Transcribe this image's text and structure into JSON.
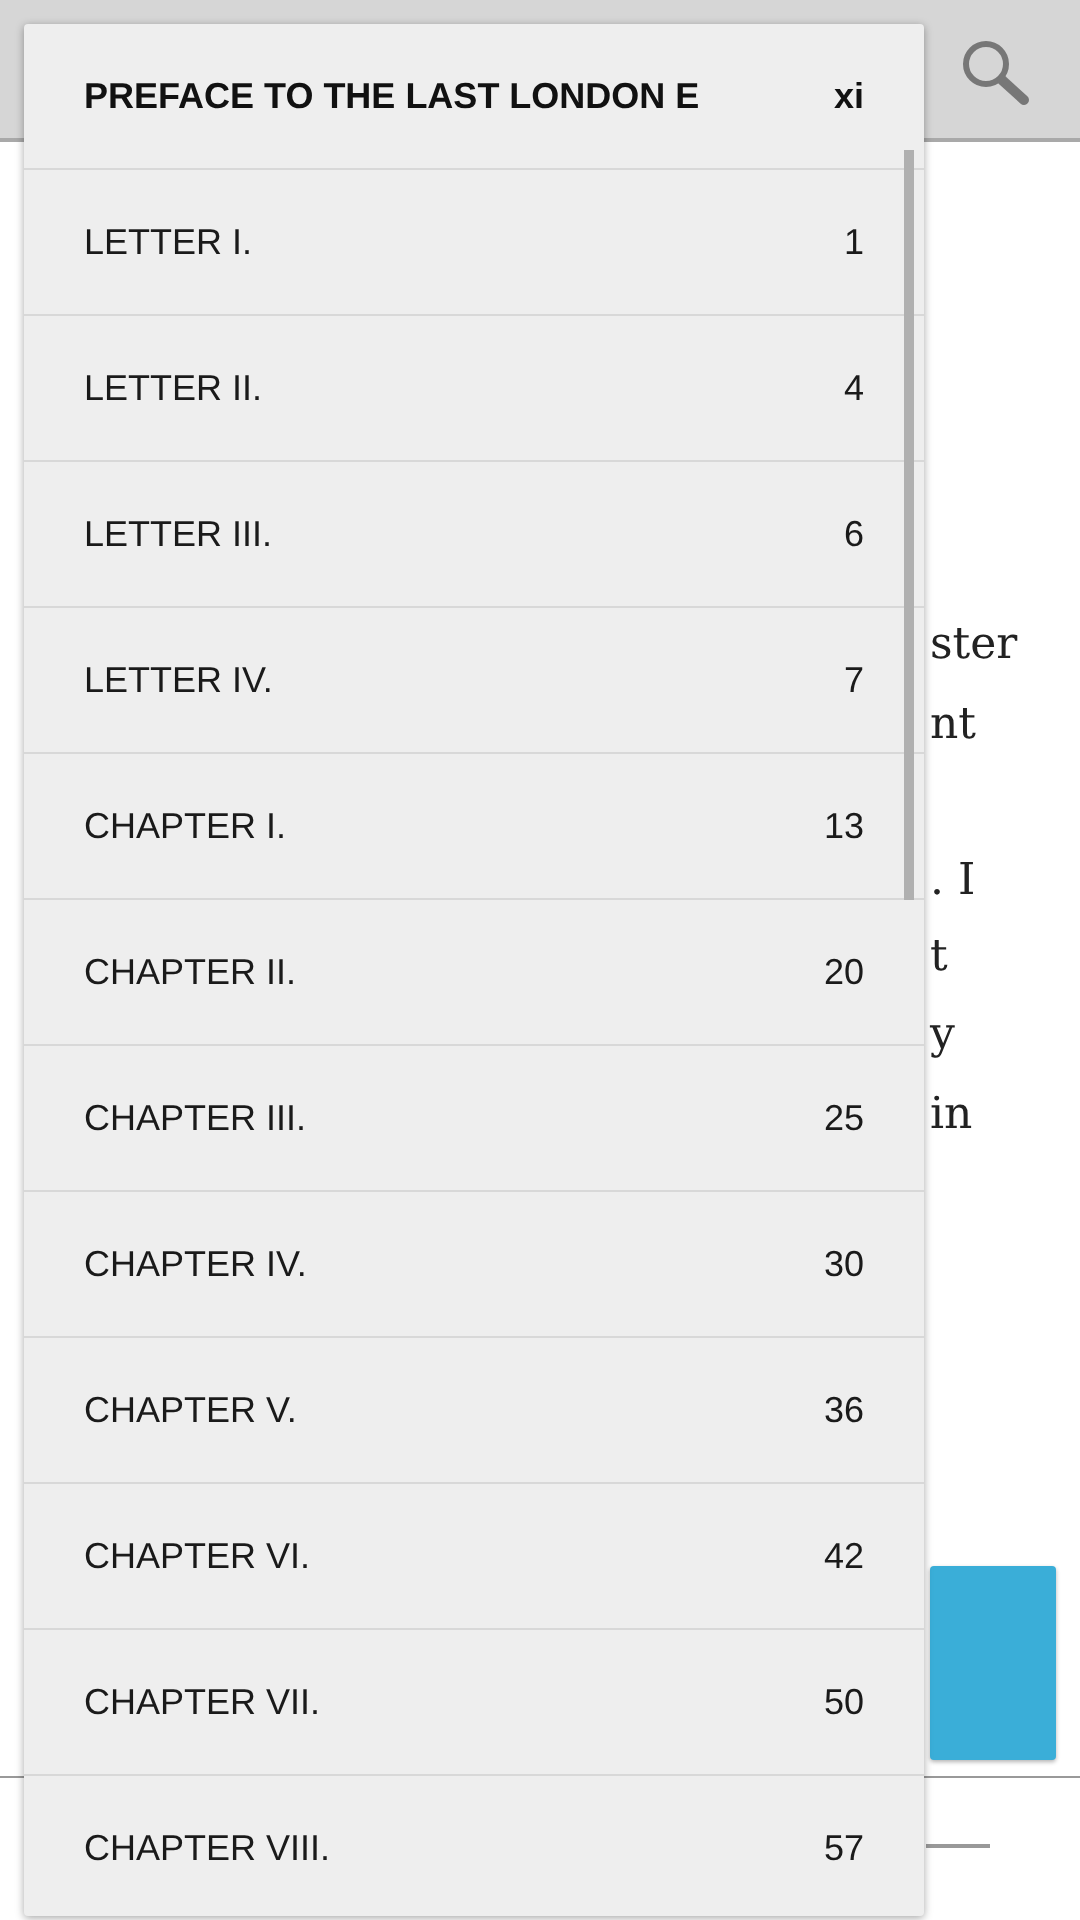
{
  "reader_text": [
    "ster",
    "nt",
    ". I",
    "t",
    "y",
    "in"
  ],
  "contents_menu": [
    {
      "title": "PREFACE TO THE LAST LONDON E",
      "page": "xi",
      "selected": true
    },
    {
      "title": "LETTER I.",
      "page": "1",
      "selected": false
    },
    {
      "title": "LETTER II.",
      "page": "4",
      "selected": false
    },
    {
      "title": "LETTER III.",
      "page": "6",
      "selected": false
    },
    {
      "title": "LETTER IV.",
      "page": "7",
      "selected": false
    },
    {
      "title": "CHAPTER I.",
      "page": "13",
      "selected": false
    },
    {
      "title": "CHAPTER II.",
      "page": "20",
      "selected": false
    },
    {
      "title": "CHAPTER III.",
      "page": "25",
      "selected": false
    },
    {
      "title": "CHAPTER IV.",
      "page": "30",
      "selected": false
    },
    {
      "title": "CHAPTER V.",
      "page": "36",
      "selected": false
    },
    {
      "title": "CHAPTER VI.",
      "page": "42",
      "selected": false
    },
    {
      "title": "CHAPTER VII.",
      "page": "50",
      "selected": false
    },
    {
      "title": "CHAPTER VIII.",
      "page": "57",
      "selected": false
    }
  ]
}
